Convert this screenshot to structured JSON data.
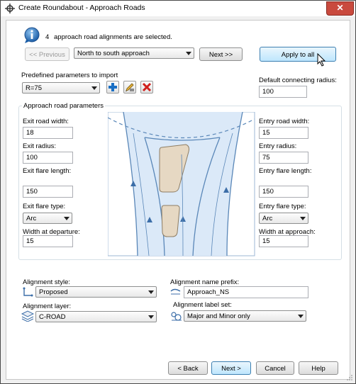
{
  "window": {
    "title": "Create Roundabout - Approach Roads",
    "close_glyph": "✕"
  },
  "info": {
    "count": "4",
    "message": "approach road alignments are selected."
  },
  "nav": {
    "previous_label": "<< Previous",
    "approach_select": "North to south approach",
    "next_label": "Next >>",
    "apply_all_label": "Apply to all"
  },
  "predefined": {
    "label": "Predefined parameters to import",
    "value": "R=75"
  },
  "default_radius": {
    "label": "Default connecting radius:",
    "value": "100"
  },
  "approach_params": {
    "group_label": "Approach road parameters",
    "exit": {
      "road_width_label": "Exit road width:",
      "road_width": "18",
      "radius_label": "Exit radius:",
      "radius": "100",
      "flare_length_label": "Exit flare length:",
      "flare_length": "150",
      "flare_type_label": "Exit flare type:",
      "flare_type": "Arc",
      "width_label": "Width at departure:",
      "width": "15"
    },
    "entry": {
      "road_width_label": "Entry road width:",
      "road_width": "15",
      "radius_label": "Entry radius:",
      "radius": "75",
      "flare_length_label": "Entry flare length:",
      "flare_length": "150",
      "flare_type_label": "Entry flare type:",
      "flare_type": "Arc",
      "width_label": "Width at approach:",
      "width": "15"
    }
  },
  "alignment": {
    "style_label": "Alignment style:",
    "style": "Proposed",
    "layer_label": "Alignment layer:",
    "layer": "C-ROAD",
    "name_prefix_label": "Alignment name prefix:",
    "name_prefix": "Approach_NS",
    "label_set_label": "Alignment label set:",
    "label_set": "Major and Minor only"
  },
  "footer": {
    "back": "< Back",
    "next": "Next >",
    "cancel": "Cancel",
    "help": "Help"
  },
  "colors": {
    "road_fill": "#dbe9f8",
    "road_edge": "#5a87b8",
    "island_fill": "#e6d8c3",
    "accent": "#3c7fb1"
  }
}
